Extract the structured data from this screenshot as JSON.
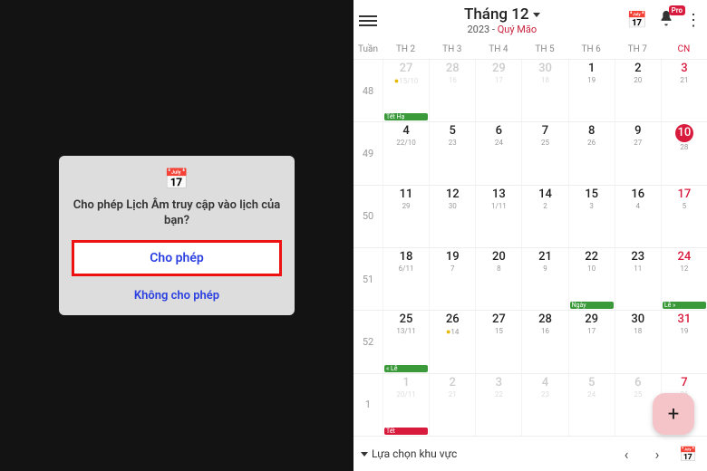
{
  "dialog": {
    "title": "Cho phép Lịch Âm truy cập vào lịch của bạn?",
    "allow": "Cho phép",
    "deny": "Không cho phép"
  },
  "header": {
    "month": "Tháng 12",
    "year_prefix": "2023 - ",
    "year_name": "Quý Mão",
    "pro": "Pro"
  },
  "week_label": "Tuần",
  "dow": [
    "TH 2",
    "TH 3",
    "TH 4",
    "TH 5",
    "TH 6",
    "TH 7",
    "CN"
  ],
  "week_nums": [
    "48",
    "49",
    "50",
    "51",
    "52",
    "1"
  ],
  "weeks": [
    [
      {
        "d": "27",
        "l": "15/10",
        "gray": true,
        "moon": true
      },
      {
        "d": "28",
        "l": "16",
        "gray": true
      },
      {
        "d": "29",
        "l": "17",
        "gray": true
      },
      {
        "d": "30",
        "l": "18",
        "gray": true
      },
      {
        "d": "1",
        "l": "19"
      },
      {
        "d": "2",
        "l": "20"
      },
      {
        "d": "3",
        "l": "21",
        "sun": true
      }
    ],
    [
      {
        "d": "4",
        "l": "22/10"
      },
      {
        "d": "5",
        "l": "23"
      },
      {
        "d": "6",
        "l": "24"
      },
      {
        "d": "7",
        "l": "25"
      },
      {
        "d": "8",
        "l": "26"
      },
      {
        "d": "9",
        "l": "27"
      },
      {
        "d": "10",
        "l": "28",
        "sun": true,
        "today": true
      }
    ],
    [
      {
        "d": "11",
        "l": "29"
      },
      {
        "d": "12",
        "l": "30"
      },
      {
        "d": "13",
        "l": "1/11"
      },
      {
        "d": "14",
        "l": "2"
      },
      {
        "d": "15",
        "l": "3"
      },
      {
        "d": "16",
        "l": "4"
      },
      {
        "d": "17",
        "l": "5",
        "sun": true
      }
    ],
    [
      {
        "d": "18",
        "l": "6/11"
      },
      {
        "d": "19",
        "l": "7"
      },
      {
        "d": "20",
        "l": "8"
      },
      {
        "d": "21",
        "l": "9"
      },
      {
        "d": "22",
        "l": "10",
        "tag": "Ngày",
        "tagc": "green"
      },
      {
        "d": "23",
        "l": "11"
      },
      {
        "d": "24",
        "l": "12",
        "sun": true,
        "tag": "Lễ »",
        "tagc": "green"
      }
    ],
    [
      {
        "d": "25",
        "l": "13/11",
        "tag": "« Lễ",
        "tagc": "green"
      },
      {
        "d": "26",
        "l": "14",
        "moon": true
      },
      {
        "d": "27",
        "l": "15"
      },
      {
        "d": "28",
        "l": "16"
      },
      {
        "d": "29",
        "l": "17"
      },
      {
        "d": "30",
        "l": "18"
      },
      {
        "d": "31",
        "l": "19",
        "sun": true
      }
    ],
    [
      {
        "d": "1",
        "l": "20/11",
        "gray": true,
        "tag": "Tết",
        "tagc": "red"
      },
      {
        "d": "2",
        "l": "21",
        "gray": true
      },
      {
        "d": "3",
        "l": "22",
        "gray": true
      },
      {
        "d": "4",
        "l": "23",
        "gray": true
      },
      {
        "d": "5",
        "l": "24",
        "gray": true
      },
      {
        "d": "6",
        "l": "25",
        "gray": true
      },
      {
        "d": "7",
        "l": "26",
        "gray": true,
        "sun": true
      }
    ]
  ],
  "row0_tag": {
    "text": "Tết Hạ",
    "color": "green"
  },
  "footer": {
    "region": "Lựa chọn khu vực"
  }
}
